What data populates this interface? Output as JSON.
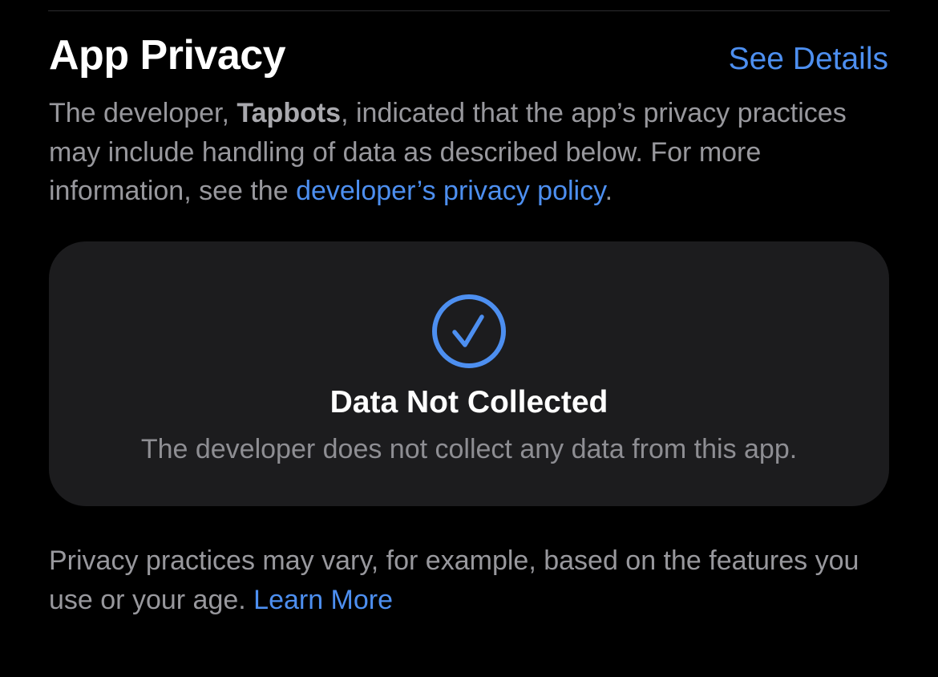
{
  "section": {
    "title": "App Privacy",
    "see_details_label": "See Details"
  },
  "description": {
    "prefix": "The developer, ",
    "developer_name": "Tapbots",
    "middle": ", indicated that the app’s privacy practices may include handling of data as described below. For more information, see the ",
    "policy_link_label": "developer’s privacy policy",
    "suffix": "."
  },
  "privacy_card": {
    "icon": "checkmark-circle-icon",
    "title": "Data Not Collected",
    "subtitle": "The developer does not collect any data from this app."
  },
  "footer": {
    "text": "Privacy practices may vary, for example, based on the features you use or your age. ",
    "learn_more_label": "Learn More"
  },
  "colors": {
    "background": "#000000",
    "card_background": "#1c1c1e",
    "accent": "#4d8ff0",
    "secondary_text": "#98989d",
    "primary_text": "#ffffff"
  }
}
